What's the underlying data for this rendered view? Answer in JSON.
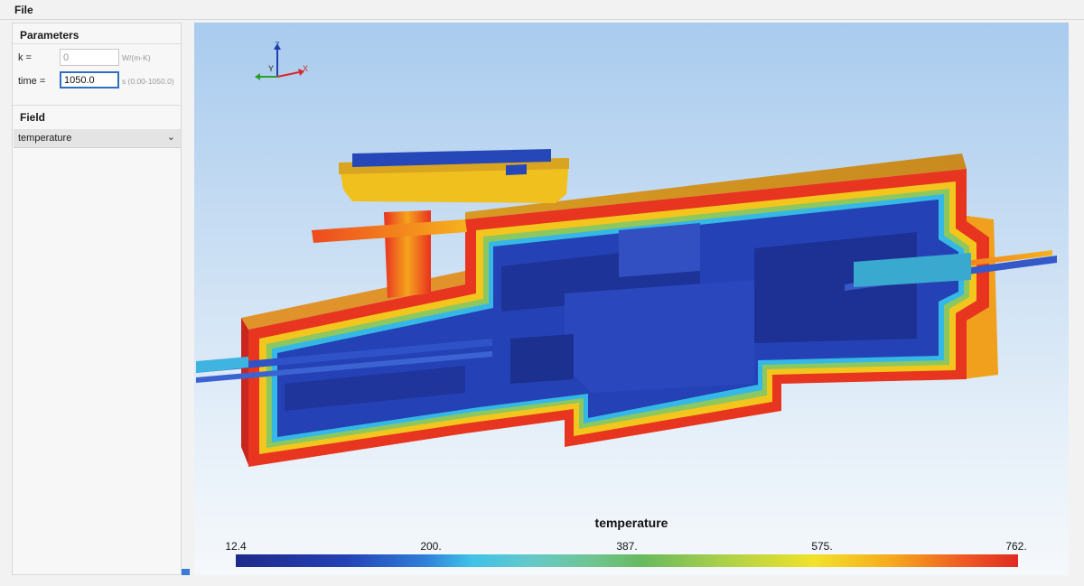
{
  "menu": {
    "file_label": "File"
  },
  "parameters": {
    "title": "Parameters",
    "k": {
      "label": "k =",
      "value": "0",
      "unit": "W/(m-K)"
    },
    "time": {
      "label": "time =",
      "value": "1050.0",
      "unit": "s (0.00-1050.0)"
    }
  },
  "field": {
    "title": "Field",
    "selected": "temperature"
  },
  "icons": {
    "chevron": "chevron-down-icon"
  },
  "viewport": {
    "axes": {
      "z": "Z",
      "y": "Y",
      "x": "X"
    },
    "colorbar": {
      "title": "temperature",
      "labels": [
        "12.4",
        "200.",
        "387.",
        "575.",
        "762."
      ]
    }
  },
  "colors": {
    "cold": "#2441b6",
    "hot": "#e02a22",
    "accent": "#2f6fbf"
  }
}
